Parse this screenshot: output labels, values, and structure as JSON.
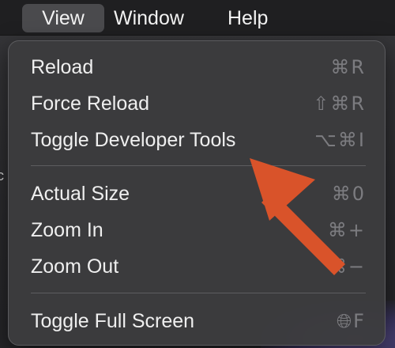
{
  "menubar": {
    "items": [
      {
        "label": "View",
        "active": true
      },
      {
        "label": "Window",
        "active": false
      },
      {
        "label": "Help",
        "active": false
      }
    ]
  },
  "menu": {
    "groups": [
      [
        {
          "label": "Reload",
          "shortcut": "⌘R"
        },
        {
          "label": "Force Reload",
          "shortcut": "⇧⌘R"
        },
        {
          "label": "Toggle Developer Tools",
          "shortcut": "⌥⌘I"
        }
      ],
      [
        {
          "label": "Actual Size",
          "shortcut": "⌘0"
        },
        {
          "label": "Zoom In",
          "shortcut": "⌘+"
        },
        {
          "label": "Zoom Out",
          "shortcut": "⌘−"
        }
      ],
      [
        {
          "label": "Toggle Full Screen",
          "shortcut": "🌐︎F"
        }
      ]
    ]
  },
  "annotation": {
    "arrow_color": "#d9532a",
    "arrow_target": "Toggle Developer Tools"
  },
  "background": {
    "fragment_left": "c"
  },
  "colors": {
    "menubar_bg": "#1f1f21",
    "menu_bg": "#3c3c3e",
    "active_item": "#4a4a4d",
    "shortcut_text": "#7c7c80"
  }
}
